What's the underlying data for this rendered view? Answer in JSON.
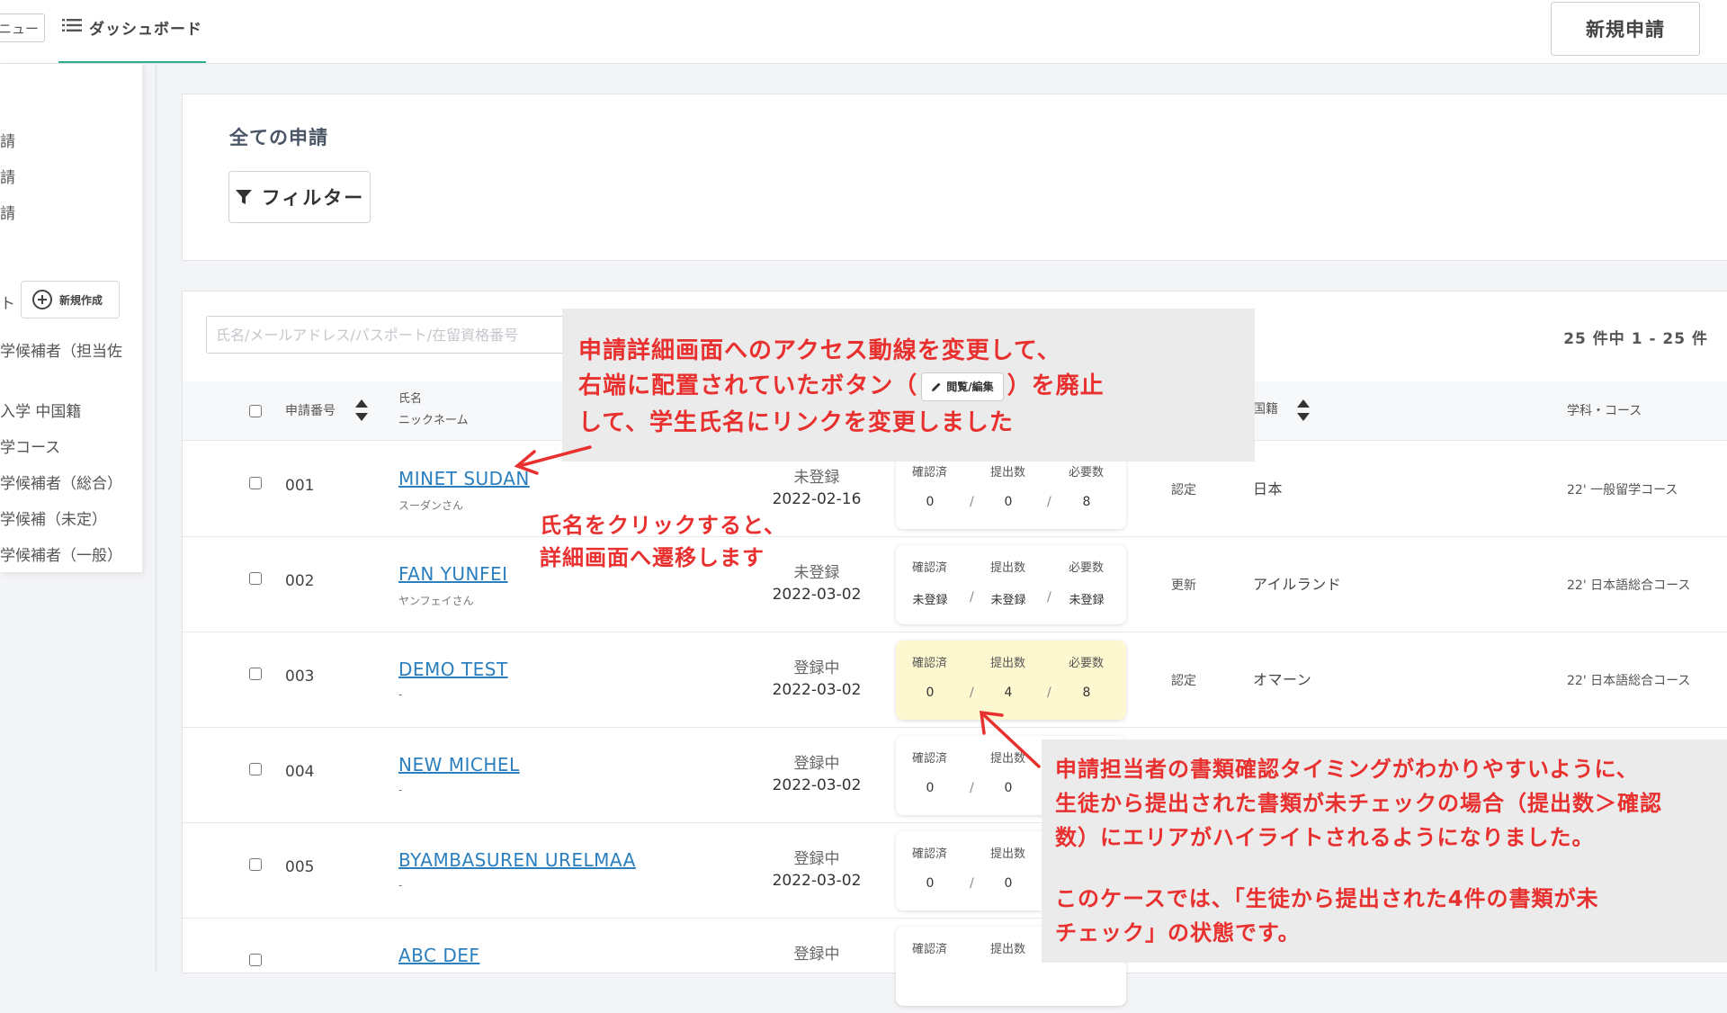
{
  "topbar": {
    "menu_label": "ニュー",
    "dashboard_label": "ダッシュボード",
    "new_application_label": "新規申請"
  },
  "sidebar": {
    "items_top": [
      "請",
      "請",
      "請"
    ],
    "list_header": "ト",
    "create_label": "新規作成",
    "lists": [
      "学候補者（担当佐",
      "入学 中国籍",
      "学コース",
      "学候補者（総合）",
      "学候補（未定）",
      "学候補者（一般）"
    ]
  },
  "title_card": {
    "title": "全ての申請",
    "filter_label": "フィルター"
  },
  "table": {
    "search_placeholder": "氏名/メールアドレス/パスポート/在留資格番号",
    "count_text": "25 件中 1 - 25 件",
    "headers": {
      "app_no": "申請番号",
      "name": "氏名",
      "nickname": "ニックネーム",
      "nationality": "国籍",
      "course": "学科・コース"
    },
    "doc_headers": [
      "確認済",
      "提出数",
      "必要数"
    ],
    "rows": [
      {
        "num": "001",
        "name": "MINET SUDAN",
        "nick": "スーダンさん",
        "status": "未登録",
        "date": "2022-02-16",
        "confirmed": "0",
        "submitted": "0",
        "required": "8",
        "type": "認定",
        "nationality": "日本",
        "course": "22' 一般留学コース"
      },
      {
        "num": "002",
        "name": "FAN YUNFEI",
        "nick": "ヤンフェイさん",
        "status": "未登録",
        "date": "2022-03-02",
        "confirmed": "未登録",
        "submitted": "未登録",
        "required": "未登録",
        "type": "更新",
        "nationality": "アイルランド",
        "course": "22' 日本語総合コース"
      },
      {
        "num": "003",
        "name": "DEMO TEST",
        "nick": "-",
        "status": "登録中",
        "date": "2022-03-02",
        "confirmed": "0",
        "submitted": "4",
        "required": "8",
        "type": "認定",
        "nationality": "オマーン",
        "course": "22' 日本語総合コース"
      },
      {
        "num": "004",
        "name": "NEW MICHEL",
        "nick": "-",
        "status": "登録中",
        "date": "2022-03-02",
        "confirmed": "0",
        "submitted": "0",
        "required": "",
        "type": "",
        "nationality": "",
        "course": ""
      },
      {
        "num": "005",
        "name": "BYAMBASUREN URELMAA",
        "nick": "-",
        "status": "登録中",
        "date": "2022-03-02",
        "confirmed": "0",
        "submitted": "0",
        "required": "",
        "type": "",
        "nationality": "",
        "course": ""
      },
      {
        "num": "",
        "name": "ABC DEF",
        "nick": "",
        "status": "登録中",
        "date": "",
        "confirmed": "",
        "submitted": "",
        "required": "",
        "type": "",
        "nationality": "",
        "course": ""
      }
    ]
  },
  "annotations": {
    "callout_top": {
      "line1": "申請詳細画面へのアクセス動線を変更して、",
      "line2_before": "右端に配置されていたボタン（",
      "button_label": "閲覧/編集",
      "line2_after": "）を廃止",
      "line3": "して、学生氏名にリンクを変更しました"
    },
    "name_note": [
      "氏名をクリックすると、",
      "詳細画面へ遷移します"
    ],
    "callout_bottom": {
      "line1": "申請担当者の書類確認タイミングがわかりやすいように、",
      "line2": "生徒から提出された書類が未チェックの場合（提出数＞確認",
      "line3": "数）にエリアがハイライトされるようになりました。",
      "line4": "このケースでは、「生徒から提出された4件の書類が未",
      "line5": "チェック」の状態です。"
    },
    "accent_color": "#e8302f",
    "highlight_color": "#fdf8cf"
  }
}
